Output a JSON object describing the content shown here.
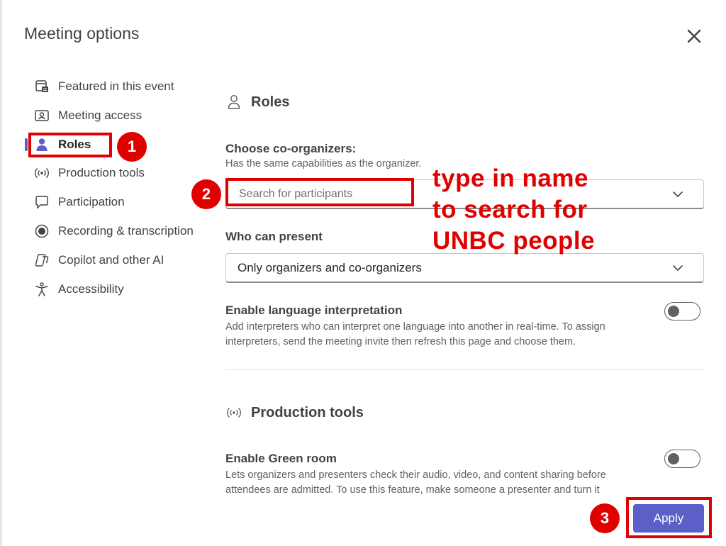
{
  "dialog": {
    "title": "Meeting options",
    "close_icon": "close-icon"
  },
  "sidebar": {
    "items": [
      {
        "label": "Featured in this event",
        "icon": "featured-icon"
      },
      {
        "label": "Meeting access",
        "icon": "meeting-access-icon"
      },
      {
        "label": "Roles",
        "icon": "person-icon",
        "active": true
      },
      {
        "label": "Production tools",
        "icon": "broadcast-icon"
      },
      {
        "label": "Participation",
        "icon": "chat-icon"
      },
      {
        "label": "Recording & transcription",
        "icon": "record-icon"
      },
      {
        "label": "Copilot and other AI",
        "icon": "copilot-icon"
      },
      {
        "label": "Accessibility",
        "icon": "accessibility-icon"
      }
    ]
  },
  "roles": {
    "heading": "Roles",
    "coorganizers_label": "Choose co-organizers:",
    "coorganizers_hint": "Has the same capabilities as the organizer.",
    "search_placeholder": "Search for participants",
    "present_label": "Who can present",
    "present_value": "Only organizers and co-organizers",
    "interpretation_label": "Enable language interpretation",
    "interpretation_hint_1": "Add interpreters who can interpret one language into another in real-time. To assign",
    "interpretation_hint_2": "interpreters, send the meeting invite then refresh this page and choose them.",
    "interpretation_enabled": false
  },
  "production": {
    "heading": "Production tools",
    "greenroom_label": "Enable Green room",
    "greenroom_hint_1": "Lets organizers and presenters check their audio, video, and content sharing before",
    "greenroom_hint_2": "attendees are admitted. To use this feature, make someone a presenter and turn it",
    "greenroom_enabled": false
  },
  "footer": {
    "apply_label": "Apply"
  },
  "annotations": {
    "step1": "1",
    "step2": "2",
    "step3": "3",
    "note_line1": "type in name",
    "note_line2": "to search for",
    "note_line3": "UNBC people"
  },
  "colors": {
    "accent": "#5b5fc7",
    "annotation_red": "#e00000"
  }
}
